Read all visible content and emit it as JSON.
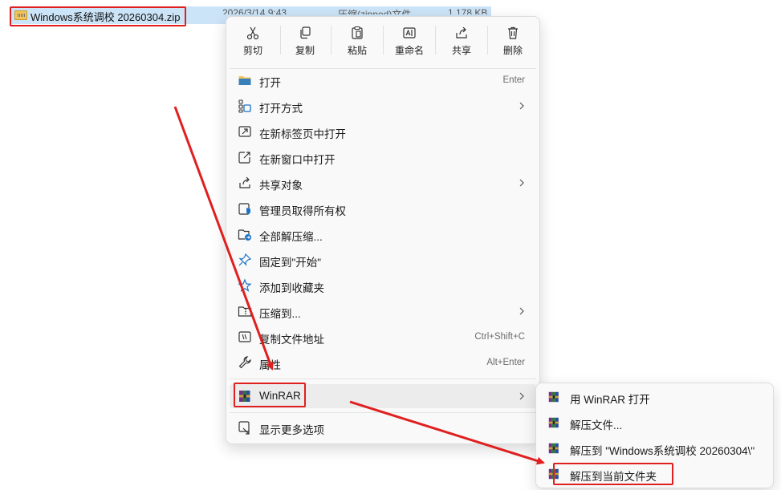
{
  "file": {
    "name": "Windows系统调校 20260304.zip",
    "date": "2026/3/14 9:43",
    "type": "压缩(zipped)文件",
    "size": "1,178 KB"
  },
  "toolbar": {
    "cut": "剪切",
    "copy": "复制",
    "paste": "粘贴",
    "rename": "重命名",
    "share": "共享",
    "delete": "删除"
  },
  "menu": {
    "open": "打开",
    "open_shortcut": "Enter",
    "open_with": "打开方式",
    "open_new_tab": "在新标签页中打开",
    "open_new_window": "在新窗口中打开",
    "share_with": "共享对象",
    "take_ownership": "管理员取得所有权",
    "extract_all": "全部解压缩...",
    "pin_start": "固定到\"开始\"",
    "add_favorites": "添加到收藏夹",
    "compress_to": "压缩到...",
    "copy_path": "复制文件地址",
    "copy_path_shortcut": "Ctrl+Shift+C",
    "properties": "属性",
    "properties_shortcut": "Alt+Enter",
    "winrar": "WinRAR",
    "more_options": "显示更多选项"
  },
  "submenu": {
    "open_winrar": "用 WinRAR 打开",
    "extract_files": "解压文件...",
    "extract_to_folder": "解压到 \"Windows系统调校 20260304\\\"",
    "extract_here": "解压到当前文件夹"
  },
  "colors": {
    "highlight_red": "#e02020",
    "selection_blue": "#cce4f7",
    "menu_bg": "#f9f9f9",
    "icon_blue": "#1a73c8"
  }
}
